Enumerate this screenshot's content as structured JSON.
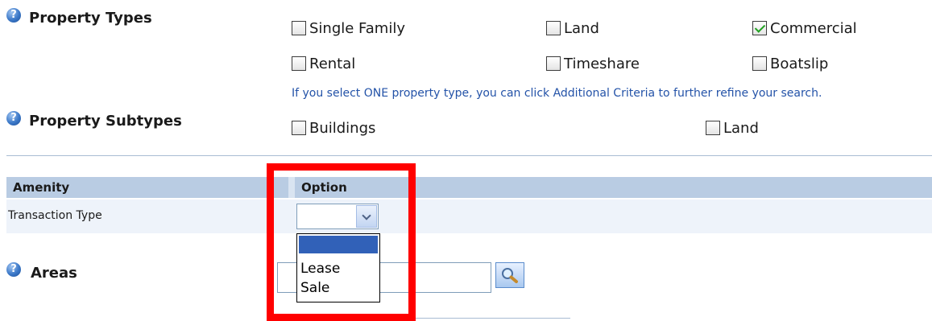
{
  "property_types": {
    "label": "Property Types",
    "options": [
      {
        "label": "Single Family",
        "checked": false
      },
      {
        "label": "Land",
        "checked": false
      },
      {
        "label": "Commercial",
        "checked": true
      },
      {
        "label": "Rental",
        "checked": false
      },
      {
        "label": "Timeshare",
        "checked": false
      },
      {
        "label": "Boatslip",
        "checked": false
      }
    ],
    "hint": "If you select ONE property type, you can click Additional Criteria to further refine your search."
  },
  "property_subtypes": {
    "label": "Property Subtypes",
    "options": [
      {
        "label": "Buildings",
        "checked": false
      },
      {
        "label": "Land",
        "checked": false
      }
    ]
  },
  "amenity_table": {
    "headers": {
      "amenity": "Amenity",
      "option": "Option"
    },
    "rows": [
      {
        "amenity": "Transaction Type",
        "selected_value": ""
      }
    ]
  },
  "transaction_dropdown": {
    "options": [
      "",
      "Lease",
      "Sale"
    ],
    "highlighted_index": 0
  },
  "areas": {
    "label": "Areas",
    "value": ""
  },
  "icons": {
    "help": "help-icon",
    "lookup": "magnifier-icon",
    "select_arrow": "chevron-down-icon"
  },
  "colors": {
    "highlight": "#ff0000",
    "hint_text": "#2453a8",
    "table_header": "#b9cce3",
    "check_mark": "#21a121"
  }
}
